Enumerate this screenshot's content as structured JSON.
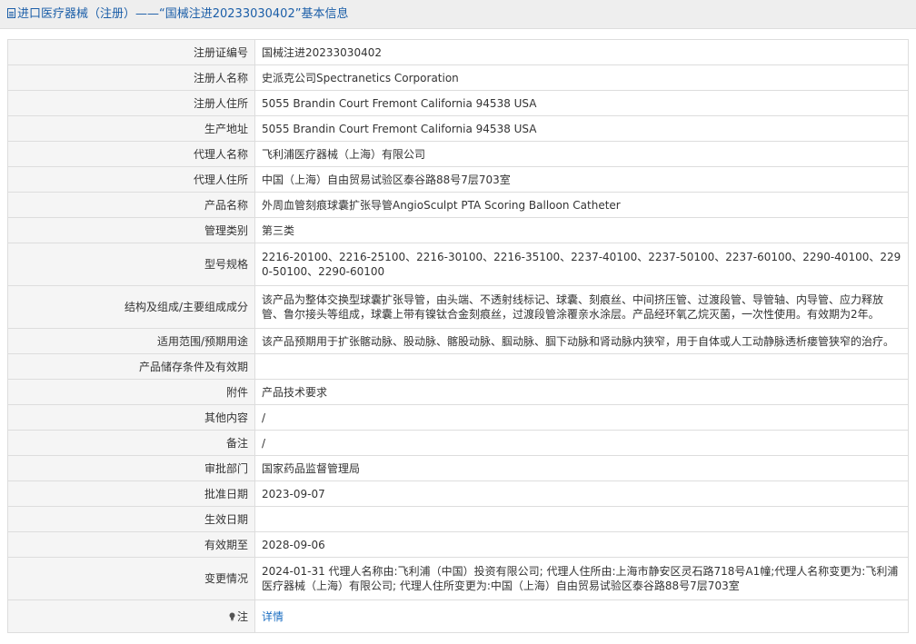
{
  "header": {
    "title": "进口医疗器械（注册）——“国械注进20233030402”基本信息"
  },
  "rows": [
    {
      "label": "注册证编号",
      "value": "国械注进20233030402"
    },
    {
      "label": "注册人名称",
      "value": "史派克公司Spectranetics Corporation"
    },
    {
      "label": "注册人住所",
      "value": "5055 Brandin Court Fremont California 94538 USA"
    },
    {
      "label": "生产地址",
      "value": "5055 Brandin Court Fremont California 94538 USA"
    },
    {
      "label": "代理人名称",
      "value": "飞利浦医疗器械（上海）有限公司"
    },
    {
      "label": "代理人住所",
      "value": "中国（上海）自由贸易试验区泰谷路88号7层703室"
    },
    {
      "label": "产品名称",
      "value": "外周血管刻痕球囊扩张导管AngioSculpt PTA Scoring Balloon Catheter"
    },
    {
      "label": "管理类别",
      "value": "第三类"
    },
    {
      "label": "型号规格",
      "value": "2216-20100、2216-25100、2216-30100、2216-35100、2237-40100、2237-50100、2237-60100、2290-40100、2290-50100、2290-60100"
    },
    {
      "label": "结构及组成/主要组成成分",
      "value": "该产品为整体交换型球囊扩张导管，由头端、不透射线标记、球囊、刻痕丝、中间挤压管、过渡段管、导管轴、内导管、应力释放管、鲁尔接头等组成，球囊上带有镍钛合金刻痕丝，过渡段管涂覆亲水涂层。产品经环氧乙烷灭菌，一次性使用。有效期为2年。"
    },
    {
      "label": "适用范围/预期用途",
      "value": "该产品预期用于扩张髂动脉、股动脉、髂股动脉、腘动脉、腘下动脉和肾动脉内狭窄，用于自体或人工动静脉透析瘘管狭窄的治疗。"
    },
    {
      "label": "产品储存条件及有效期",
      "value": ""
    },
    {
      "label": "附件",
      "value": "产品技术要求"
    },
    {
      "label": "其他内容",
      "value": "/"
    },
    {
      "label": "备注",
      "value": "/"
    },
    {
      "label": "审批部门",
      "value": "国家药品监督管理局"
    },
    {
      "label": "批准日期",
      "value": "2023-09-07"
    },
    {
      "label": "生效日期",
      "value": ""
    },
    {
      "label": "有效期至",
      "value": "2028-09-06"
    },
    {
      "label": "变更情况",
      "value": "2024-01-31 代理人名称由:飞利浦（中国）投资有限公司; 代理人住所由:上海市静安区灵石路718号A1幢;代理人名称变更为:飞利浦医疗器械（上海）有限公司; 代理人住所变更为:中国（上海）自由贸易试验区泰谷路88号7层703室"
    }
  ],
  "note": {
    "label": "注",
    "link_text": "详情"
  }
}
